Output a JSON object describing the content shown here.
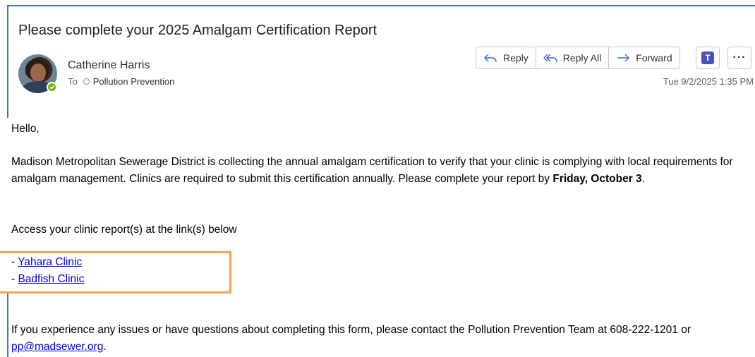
{
  "email": {
    "subject": "Please complete your 2025 Amalgam Certification Report",
    "sender_name": "Catherine Harris",
    "to_label": "To",
    "recipient": "Pollution Prevention",
    "timestamp": "Tue 9/2/2025 1:35 PM"
  },
  "toolbar": {
    "reply_label": "Reply",
    "reply_all_label": "Reply All",
    "forward_label": "Forward",
    "teams_glyph": "T",
    "more_label": "···"
  },
  "body": {
    "greeting": "Hello,",
    "para1_text": "Madison Metropolitan Sewerage District is collecting the annual amalgam certification to verify that your clinic is complying with local requirements for amalgam management. Clinics are required to submit this certification annually. Please complete your report by ",
    "para1_deadline": "Friday, October 3",
    "para1_end": ".",
    "para2": "Access your clinic report(s) at the link(s) below",
    "links": [
      {
        "prefix": "- ",
        "label": "Yahara Clinic"
      },
      {
        "prefix": "- ",
        "label": "Badfish Clinic"
      }
    ],
    "para3_text": "If you experience any issues or have questions about completing this form, please contact the Pollution Prevention Team at 608-222-1201 or ",
    "para3_email": "pp@madsewer.org",
    "para3_end": "."
  },
  "colors": {
    "accent_frame": "#4472c4",
    "highlight": "#f4a14f",
    "link": "#0000ee",
    "presence": "#6bb700",
    "teams": "#4b53bc"
  },
  "icons": [
    "reply-icon",
    "reply-all-icon",
    "forward-icon",
    "teams-icon",
    "more-icon",
    "presence-available-icon"
  ]
}
